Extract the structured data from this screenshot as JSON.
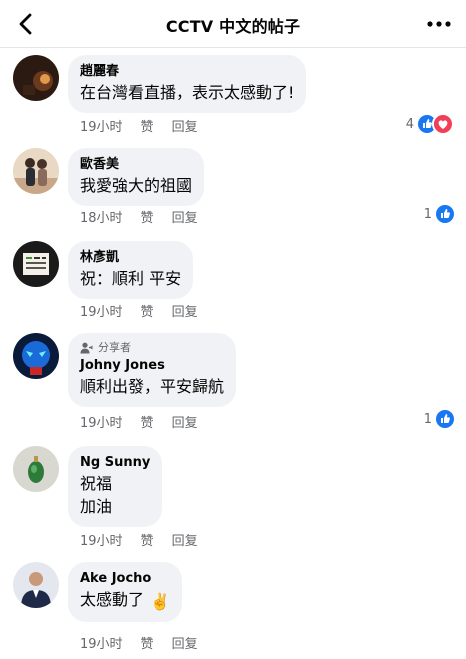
{
  "header": {
    "title": "CCTV 中文的帖子"
  },
  "actions": {
    "like_label": "赞",
    "reply_label": "回复"
  },
  "comments": [
    {
      "author": "趙麗春",
      "lines": [
        "在台灣看直播，表示太感動了!"
      ],
      "time": "19小时",
      "reaction_count": "4",
      "reactions": [
        "like",
        "love"
      ]
    },
    {
      "author": "歐香美",
      "lines": [
        "我愛強大的祖國"
      ],
      "time": "18小时",
      "reaction_count": "1",
      "reactions": [
        "like"
      ]
    },
    {
      "author": "林彥凱",
      "lines": [
        "祝：順利 平安"
      ],
      "time": "19小时",
      "reaction_count": "",
      "reactions": []
    },
    {
      "author": "Johny Jones",
      "badge": "分享者",
      "lines": [
        "順利出發，平安歸航"
      ],
      "time": "19小时",
      "reaction_count": "1",
      "reactions": [
        "like"
      ]
    },
    {
      "author": "Ng Sunny",
      "lines": [
        "祝福",
        "加油"
      ],
      "time": "19小时",
      "reaction_count": "",
      "reactions": []
    },
    {
      "author": "Ake Jocho",
      "lines": [
        "太感動了"
      ],
      "emoji": "✌️",
      "time": "19小时",
      "reaction_count": "",
      "reactions": []
    }
  ],
  "icons": {
    "back": "chevron-left-icon",
    "more": "more-horizontal-icon",
    "like": "like-reaction-icon",
    "love": "love-reaction-icon",
    "sharer": "person-share-icon"
  },
  "colors": {
    "like_blue": "#1877f2",
    "love_red": "#f33e58",
    "bubble_bg": "#f0f2f5",
    "meta_gray": "#65676b"
  }
}
